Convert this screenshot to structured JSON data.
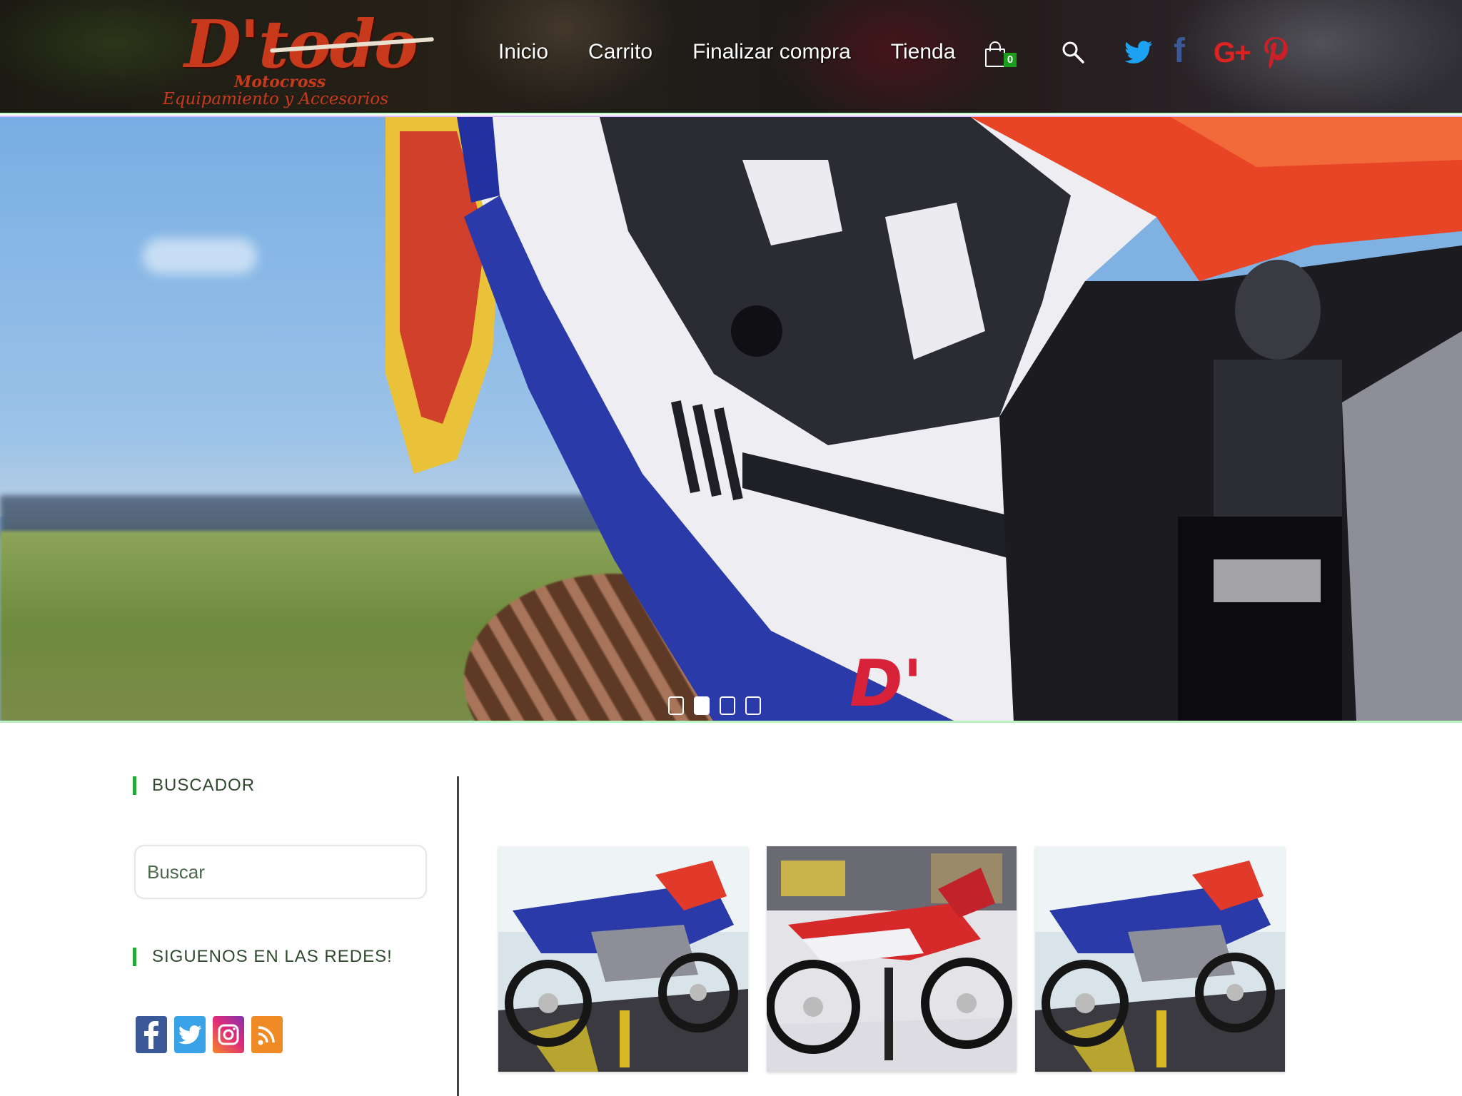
{
  "header": {
    "logo": {
      "main": "D'todo",
      "line1": "Motocross",
      "line2": "Equipamiento y Accesorios"
    },
    "nav": [
      {
        "label": "Inicio"
      },
      {
        "label": "Carrito"
      },
      {
        "label": "Finalizar compra"
      },
      {
        "label": "Tienda"
      }
    ],
    "cart": {
      "icon": "cart-icon",
      "count": "0"
    },
    "search_icon": "search-icon",
    "social": [
      "twitter-icon",
      "facebook-icon",
      "google-plus-icon",
      "pinterest-icon"
    ],
    "google_plus_label": "G+"
  },
  "hero": {
    "slides_count": 4,
    "active_slide": 2,
    "decal_text": "D'"
  },
  "sidebar": {
    "search_widget": {
      "title": "BUSCADOR",
      "placeholder": "Buscar"
    },
    "social_widget": {
      "title": "SIGUENOS EN LAS REDES!",
      "icons": [
        "facebook-icon",
        "twitter-icon",
        "instagram-icon",
        "rss-icon"
      ]
    }
  },
  "products": [
    {
      "image": "blue-motocross-bike-photo"
    },
    {
      "image": "red-motocross-bike-photo"
    },
    {
      "image": "blue-motocross-bike-photo"
    }
  ],
  "colors": {
    "brand_red": "#c93a1d",
    "accent_green": "#22aa33",
    "twitter": "#1da1f2",
    "facebook": "#3b5998",
    "google_plus": "#dd2222",
    "pinterest": "#cb2027"
  }
}
